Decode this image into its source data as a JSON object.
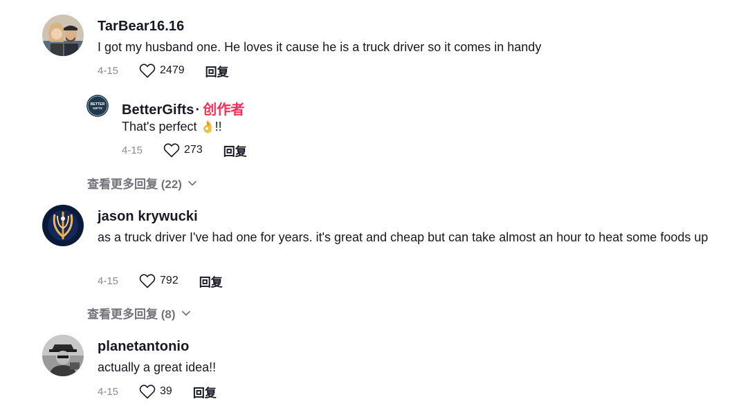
{
  "comments": [
    {
      "username": "TarBear16.16",
      "text": "I got my husband one. He loves it cause he is a truck driver so it comes in handy",
      "date": "4-15",
      "likes": "2479",
      "reply_label": "回复",
      "reply": {
        "username": "BetterGifts",
        "creator_label": "创作者",
        "text_before": "That's perfect ",
        "emoji": "👌",
        "text_after": "!!",
        "date": "4-15",
        "likes": "273",
        "reply_label": "回复",
        "avatar_text_top": "BETTER",
        "avatar_text_bottom": "GIFTS"
      },
      "view_more": "查看更多回复 (22)"
    },
    {
      "username": "jason krywucki",
      "text": "as a truck driver I've had one for years. it's great and cheap but can take almost an hour to heat some foods up",
      "date": "4-15",
      "likes": "792",
      "reply_label": "回复",
      "view_more": "查看更多回复 (8)"
    },
    {
      "username": "planetantonio",
      "text": "actually a great idea!!",
      "date": "4-15",
      "likes": "39",
      "reply_label": "回复"
    }
  ],
  "colors": {
    "creator": "#fe2c55",
    "muted": "#8a8b91",
    "text": "#161823"
  }
}
